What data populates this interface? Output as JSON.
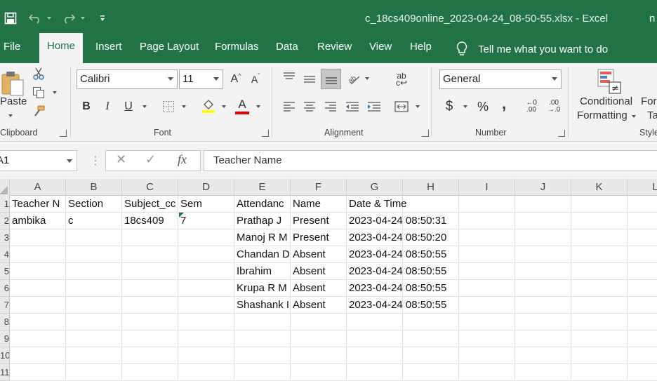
{
  "app": {
    "window_title": "c_18cs409online_2023-04-24_08-50-55.xlsx  -  Excel",
    "account_initials": "n"
  },
  "tabs": [
    "File",
    "Home",
    "Insert",
    "Page Layout",
    "Formulas",
    "Data",
    "Review",
    "View",
    "Help"
  ],
  "active_tab": "Home",
  "tell_me": "Tell me what you want to do",
  "ribbon": {
    "clipboard": {
      "label": "Clipboard",
      "paste": "Paste"
    },
    "font": {
      "label": "Font",
      "family": "Calibri",
      "size": "11"
    },
    "alignment": {
      "label": "Alignment"
    },
    "number": {
      "label": "Number",
      "format": "General",
      "currency": "$",
      "percent": "%",
      "comma": ","
    },
    "styles": {
      "label": "Style",
      "conditional_line1": "Conditional",
      "conditional_line2": "Formatting",
      "format_table_line1": "For",
      "format_table_line2": "Ta"
    }
  },
  "formula_bar": {
    "name_box": "A1",
    "fx": "fx",
    "content": "Teacher Name"
  },
  "columns": [
    "A",
    "B",
    "C",
    "D",
    "E",
    "F",
    "G",
    "H",
    "I",
    "J",
    "K",
    "L"
  ],
  "rows": [
    [
      "Teacher N",
      "Section",
      "Subject_cc",
      "Sem",
      "Attendanc",
      "Name",
      "Date & Time",
      "",
      "",
      "",
      "",
      ""
    ],
    [
      "ambika",
      "c",
      "18cs409",
      "7",
      "Prathap J",
      "Present",
      "2023-04-24 08:50:31",
      "",
      "",
      "",
      "",
      ""
    ],
    [
      "",
      "",
      "",
      "",
      "Manoj R M",
      "Present",
      "2023-04-24 08:50:20",
      "",
      "",
      "",
      "",
      ""
    ],
    [
      "",
      "",
      "",
      "",
      "Chandan D",
      "Absent",
      "2023-04-24 08:50:55",
      "",
      "",
      "",
      "",
      ""
    ],
    [
      "",
      "",
      "",
      "",
      "Ibrahim",
      "Absent",
      "2023-04-24 08:50:55",
      "",
      "",
      "",
      "",
      ""
    ],
    [
      "",
      "",
      "",
      "",
      "Krupa R M",
      "Absent",
      "2023-04-24 08:50:55",
      "",
      "",
      "",
      "",
      ""
    ],
    [
      "",
      "",
      "",
      "",
      "Shashank I",
      "Absent",
      "2023-04-24 08:50:55",
      "",
      "",
      "",
      "",
      ""
    ],
    [
      "",
      "",
      "",
      "",
      "",
      "",
      "",
      "",
      "",
      "",
      "",
      ""
    ],
    [
      "",
      "",
      "",
      "",
      "",
      "",
      "",
      "",
      "",
      "",
      "",
      ""
    ],
    [
      "",
      "",
      "",
      "",
      "",
      "",
      "",
      "",
      "",
      "",
      "",
      ""
    ],
    [
      "",
      "",
      "",
      "",
      "",
      "",
      "",
      "",
      "",
      "",
      "",
      ""
    ]
  ],
  "row_numbers": [
    "1",
    "2",
    "3",
    "4",
    "5",
    "6",
    "7",
    "8",
    "9",
    "10",
    "11"
  ],
  "colors": {
    "excel_green": "#217346",
    "ribbon_bg": "#f3f3f3"
  }
}
